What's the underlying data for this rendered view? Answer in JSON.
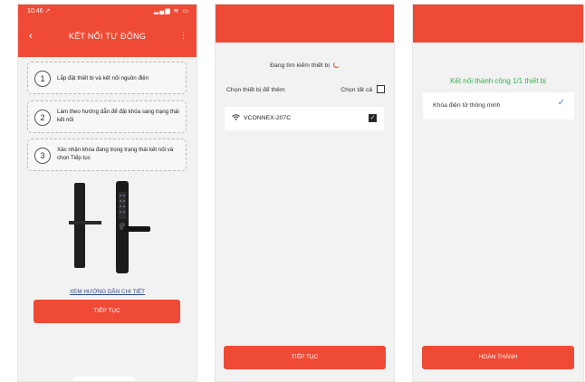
{
  "screen1": {
    "status": {
      "time": "10:46 ↗",
      "icons": "▂▄▆ ≋ ▭"
    },
    "header": {
      "back_icon": "‹",
      "title": "KẾT NỐI TỰ ĐỘNG",
      "more_icon": "⋮"
    },
    "steps": [
      {
        "num": "1",
        "text": "Lắp đặt thiết bị và kết nối nguồn điện"
      },
      {
        "num": "2",
        "text": "Làm theo hướng dẫn để đặt khóa sang trạng thái kết nối"
      },
      {
        "num": "3",
        "text": "Xác nhận khóa đang trong trạng thái kết nối và chọn Tiếp tục"
      }
    ],
    "guide_link": "XEM HƯỚNG DẪN CHI TIẾT",
    "continue_label": "TIẾP TỤC"
  },
  "screen2": {
    "searching_text": "Đang tìm kiếm thiết bị",
    "choose_label": "Chọn thiết bị để thêm",
    "select_all_label": "Chọn tất cả",
    "devices": [
      {
        "name": "VCONNEX-207C",
        "checked": true
      }
    ],
    "continue_label": "TIẾP TỤC"
  },
  "screen3": {
    "success_text": "Kết nối thành công 1/1 thiết bị",
    "results": [
      {
        "name": "Khóa điện tử thông minh",
        "status_icon": "✓"
      }
    ],
    "done_label": "HOÀN THÀNH"
  },
  "colors": {
    "accent": "#ef4a35",
    "success": "#35b24a",
    "link": "#2d4a8a",
    "check": "#4a90d9"
  }
}
